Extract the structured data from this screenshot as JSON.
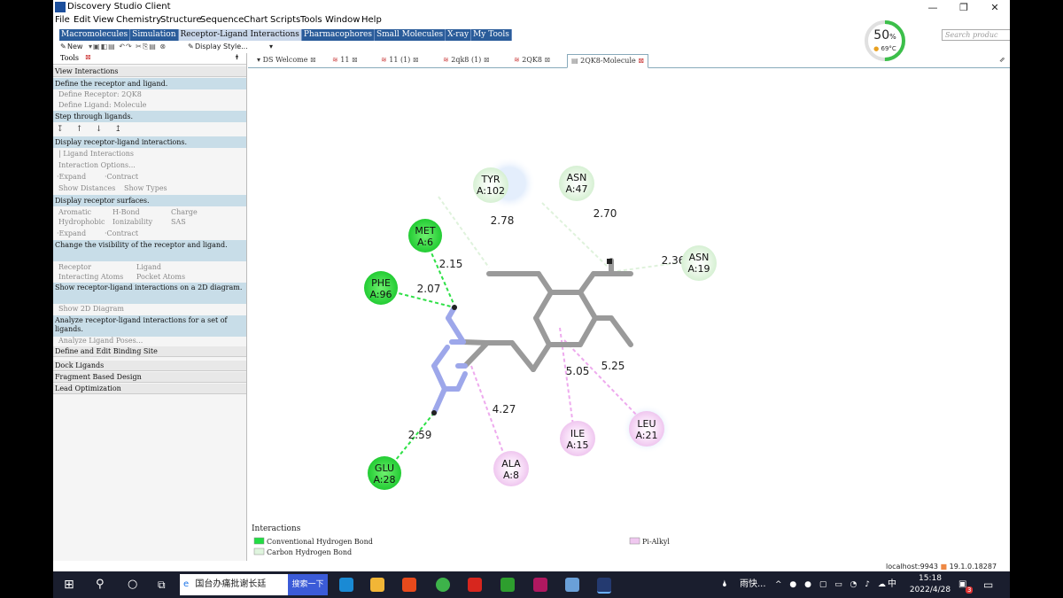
{
  "window": {
    "title": "Discovery Studio Client",
    "minimize": "—",
    "maximize": "❐",
    "close": "✕"
  },
  "menu": [
    "File",
    "Edit",
    "View",
    "Chemistry",
    "Structure",
    "Sequence",
    "Chart",
    "Scripts",
    "Tools",
    "Window",
    "Help"
  ],
  "category_tabs": [
    "Macromolecules",
    "Simulation",
    "Receptor-Ligand Interactions",
    "Pharmacophores",
    "Small Molecules",
    "X-ray",
    "My Tools"
  ],
  "selected_category": "Receptor-Ligand Interactions",
  "search_placeholder": "Search produc",
  "toolbar": {
    "new_label": "New",
    "display_style_label": "Display Style..."
  },
  "cpu_gauge": {
    "value": "50",
    "unit": "%",
    "temperature": "69°C",
    "level": 50
  },
  "tools_panel": {
    "title": "Tools",
    "view_interactions": "View Interactions",
    "define_header": "Define the receptor and ligand.",
    "define_receptor": "Define Receptor: 2QK8",
    "define_ligand": "Define Ligand: Molecule",
    "step_header": "Step through ligands.",
    "display_header": "Display receptor-ligand interactions.",
    "ligand_interactions": "Ligand Interactions",
    "interaction_options": "Interaction Options...",
    "expand": "Expand",
    "contract": "Contract",
    "show_distances": "Show Distances",
    "show_types": "Show Types",
    "surfaces_header": "Display receptor surfaces.",
    "aromatic": "Aromatic",
    "hbond": "H-Bond",
    "charge": "Charge",
    "hydrophobic": "Hydrophobic",
    "ionizability": "Ionizability",
    "sas": "SAS",
    "visibility_header": "Change the visibility of the receptor and ligand.",
    "receptor": "Receptor",
    "ligand": "Ligand",
    "interacting_atoms": "Interacting Atoms",
    "pocket_atoms": "Pocket Atoms",
    "diagram_header": "Show receptor-ligand interactions on a 2D diagram.",
    "show_2d": "Show 2D Diagram",
    "analyze_header": "Analyze receptor-ligand interactions for a set of ligands.",
    "analyze_poses": "Analyze Ligand Poses...",
    "binding_site": "Define and Edit Binding Site",
    "dock": "Dock Ligands",
    "fragment": "Fragment Based Design",
    "lead": "Lead Optimization"
  },
  "doc_tabs": [
    "DS Welcome",
    "11",
    "11 (1)",
    "2qk8 (1)",
    "2QK8",
    "2QK8-Molecule"
  ],
  "active_doc_tab": "2QK8-Molecule",
  "diagram": {
    "residues": [
      {
        "name": "TYR",
        "id": "A:102",
        "type": "carbon"
      },
      {
        "name": "ASN",
        "id": "A:47",
        "type": "carbon"
      },
      {
        "name": "MET",
        "id": "A:6",
        "type": "conventional"
      },
      {
        "name": "ASN",
        "id": "A:19",
        "type": "carbon"
      },
      {
        "name": "PHE",
        "id": "A:96",
        "type": "conventional"
      },
      {
        "name": "ILE",
        "id": "A:15",
        "type": "pialkyl"
      },
      {
        "name": "LEU",
        "id": "A:21",
        "type": "pialkyl"
      },
      {
        "name": "ALA",
        "id": "A:8",
        "type": "pialkyl"
      },
      {
        "name": "GLU",
        "id": "A:28",
        "type": "conventional"
      }
    ],
    "distances": [
      "2.78",
      "2.70",
      "2.15",
      "2.36",
      "2.07",
      "5.05",
      "5.25",
      "4.27",
      "2.59"
    ],
    "legend_title": "Interactions",
    "legend": [
      {
        "label": "Conventional Hydrogen Bond",
        "color": "#22dd44"
      },
      {
        "label": "Carbon Hydrogen Bond",
        "color": "#dff5de"
      },
      {
        "label": "Pi-Alkyl",
        "color": "#f0c8f0"
      }
    ]
  },
  "status": {
    "server": "localhost:9943",
    "version": "19.1.0.18287"
  },
  "taskbar": {
    "search_text": "国台办痛批谢长廷",
    "search_button": "搜索一下",
    "weather": "雨快...",
    "ime": "中",
    "time": "15:18",
    "date": "2022/4/28",
    "badge": "3"
  }
}
